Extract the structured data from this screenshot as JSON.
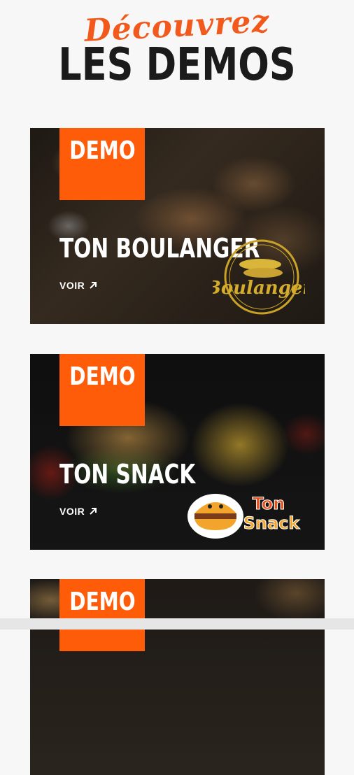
{
  "header": {
    "script_title": "Découvrez",
    "main_title": "LES DEMOS"
  },
  "cards": [
    {
      "badge": "DEMO",
      "title": "TON BOULANGER",
      "link_label": "VOIR",
      "logo_text": "Boulanger"
    },
    {
      "badge": "DEMO",
      "title": "TON SNACK",
      "link_label": "VOIR",
      "logo_text_line1": "Ton",
      "logo_text_line2": "Snack"
    },
    {
      "badge": "DEMO"
    }
  ],
  "colors": {
    "accent": "#ff5c0a",
    "script_orange": "#f25a1d",
    "title_dark": "#1b1b1b",
    "background": "#f7f7f7"
  }
}
